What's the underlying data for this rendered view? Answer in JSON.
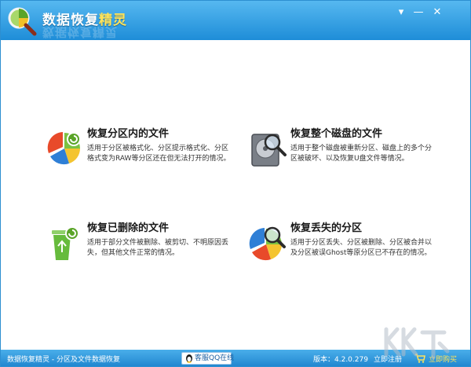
{
  "window": {
    "title_main": "数据恢复",
    "title_accent": "精灵",
    "title_reflection": "数据恢复精灵"
  },
  "controls": {
    "menu": "▾",
    "minimize": "—",
    "close": "✕"
  },
  "options": [
    {
      "title": "恢复分区内的文件",
      "desc": "适用于分区被格式化、分区提示格式化、分区格式变为RAW等分区还在但无法打开的情况。",
      "icon": "pie-chart-icon"
    },
    {
      "title": "恢复整个磁盘的文件",
      "desc": "适用于整个磁盘被重新分区、磁盘上的多个分区被破坏、以及恢复U盘文件等情况。",
      "icon": "hard-disk-magnifier-icon"
    },
    {
      "title": "恢复已删除的文件",
      "desc": "适用于部分文件被删除、被剪切、不明原因丢失，但其他文件正常的情况。",
      "icon": "recycle-bin-icon"
    },
    {
      "title": "恢复丢失的分区",
      "desc": "适用于分区丢失、分区被删除、分区被合并以及分区被误Ghost等原分区已不存在的情况。",
      "icon": "pie-magnifier-icon"
    }
  ],
  "statusbar": {
    "app_info": "数据恢复精灵 - 分区及文件数据恢复",
    "qq_support": "客服QQ在线",
    "version": "版本：4.2.0.279",
    "register": "立即注册",
    "buy": "立即购买"
  },
  "colors": {
    "titlebar": "#1e8dd8",
    "accent_yellow": "#ffe35a",
    "statusbar": "#1f86cf"
  }
}
